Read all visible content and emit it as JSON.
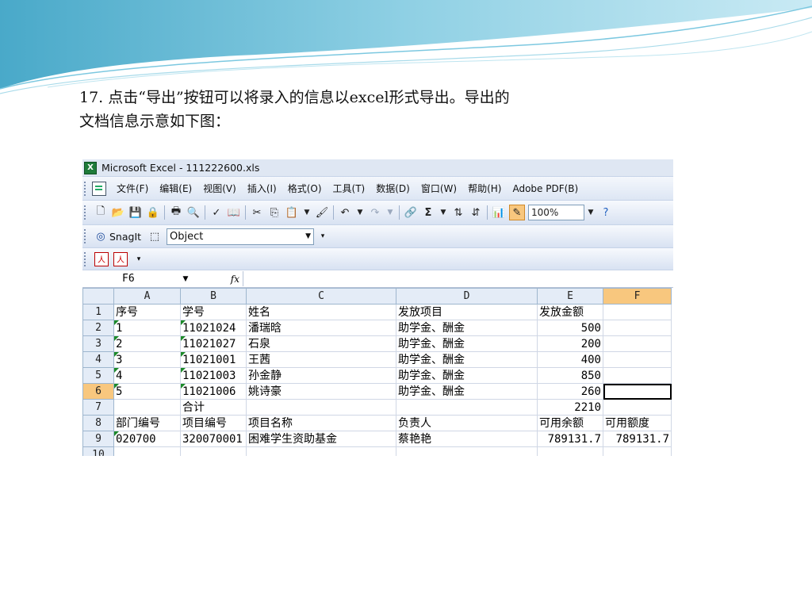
{
  "caption": {
    "line1": "17. 点击“导出”按钮可以将录入的信息以excel形式导出。导出的",
    "line2": "文档信息示意如下图："
  },
  "excel": {
    "title": "Microsoft Excel - 111222600.xls",
    "menu": [
      "文件(F)",
      "编辑(E)",
      "视图(V)",
      "插入(I)",
      "格式(O)",
      "工具(T)",
      "数据(D)",
      "窗口(W)",
      "帮助(H)",
      "Adobe PDF(B)"
    ],
    "zoom": "100%",
    "snagit_label": "SnagIt",
    "object_select": "Object",
    "name_box": "F6",
    "fx_label": "fx",
    "columns": [
      "A",
      "B",
      "C",
      "D",
      "E",
      "F"
    ],
    "selected_column": "F",
    "selected_row": "6",
    "rows": [
      {
        "n": "1",
        "cells": [
          "序号",
          "学号",
          "姓名",
          "发放项目",
          "发放金额",
          ""
        ]
      },
      {
        "n": "2",
        "cells": [
          "1",
          "11021024",
          "潘瑞晗",
          "助学金、酬金",
          "500",
          ""
        ]
      },
      {
        "n": "3",
        "cells": [
          "2",
          "11021027",
          "石泉",
          "助学金、酬金",
          "200",
          ""
        ]
      },
      {
        "n": "4",
        "cells": [
          "3",
          "11021001",
          "王茜",
          "助学金、酬金",
          "400",
          ""
        ]
      },
      {
        "n": "5",
        "cells": [
          "4",
          "11021003",
          "孙金静",
          "助学金、酬金",
          "850",
          ""
        ]
      },
      {
        "n": "6",
        "cells": [
          "5",
          "11021006",
          "姚诗豪",
          "助学金、酬金",
          "260",
          ""
        ]
      },
      {
        "n": "7",
        "cells": [
          "",
          "合计",
          "",
          "",
          "2210",
          ""
        ]
      },
      {
        "n": "8",
        "cells": [
          "部门编号",
          "项目编号",
          "项目名称",
          "负责人",
          "可用余额",
          "可用额度"
        ]
      },
      {
        "n": "9",
        "cells": [
          "020700",
          "320070001",
          "困难学生资助基金",
          "蔡艳艳",
          "789131.7",
          "789131.7"
        ]
      },
      {
        "n": "10",
        "cells": [
          "",
          "",
          "",
          "",
          "",
          ""
        ]
      }
    ]
  },
  "colors": {
    "header_bg": "#e4ecf7",
    "selected_header": "#f8c77e",
    "toolbar": "#dde6f4"
  }
}
